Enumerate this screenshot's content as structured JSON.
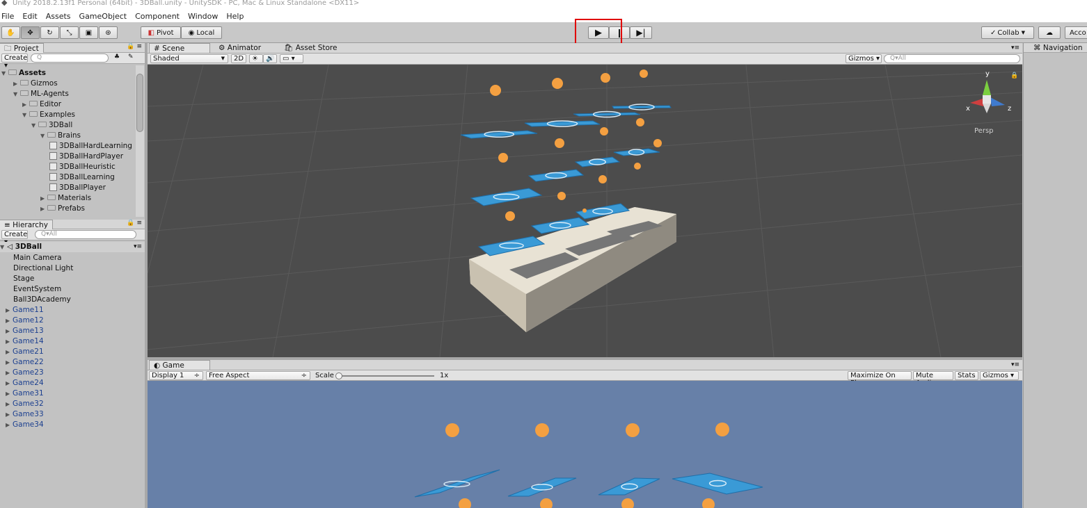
{
  "window": {
    "title": "Unity 2018.2.13f1 Personal (64bit) - 3DBall.unity - UnitySDK - PC, Mac & Linux Standalone <DX11>"
  },
  "menu": [
    "File",
    "Edit",
    "Assets",
    "GameObject",
    "Component",
    "Window",
    "Help"
  ],
  "toolbar": {
    "pivot": "Pivot",
    "local": "Local",
    "collab": "Collab",
    "account": "Acco"
  },
  "project": {
    "tab": "Project",
    "create": "Create",
    "items": [
      {
        "label": "Assets",
        "depth": 0,
        "expanded": true,
        "bold": true
      },
      {
        "label": "Gizmos",
        "depth": 1,
        "expanded": false
      },
      {
        "label": "ML-Agents",
        "depth": 1,
        "expanded": true
      },
      {
        "label": "Editor",
        "depth": 2,
        "expanded": false
      },
      {
        "label": "Examples",
        "depth": 2,
        "expanded": true
      },
      {
        "label": "3DBall",
        "depth": 3,
        "expanded": true
      },
      {
        "label": "Brains",
        "depth": 4,
        "expanded": true
      },
      {
        "label": "3DBallHardLearning",
        "depth": 5,
        "asset": true
      },
      {
        "label": "3DBallHardPlayer",
        "depth": 5,
        "asset": true
      },
      {
        "label": "3DBallHeuristic",
        "depth": 5,
        "asset": true
      },
      {
        "label": "3DBallLearning",
        "depth": 5,
        "asset": true
      },
      {
        "label": "3DBallPlayer",
        "depth": 5,
        "asset": true
      },
      {
        "label": "Materials",
        "depth": 4,
        "expanded": false
      },
      {
        "label": "Prefabs",
        "depth": 4,
        "expanded": false
      }
    ]
  },
  "hierarchy": {
    "tab": "Hierarchy",
    "create": "Create",
    "search_placeholder": "Q▾All",
    "scene": "3DBall",
    "items": [
      {
        "label": "Main Camera",
        "prefab": false,
        "expandable": false
      },
      {
        "label": "Directional Light",
        "prefab": false,
        "expandable": false
      },
      {
        "label": "Stage",
        "prefab": false,
        "expandable": false
      },
      {
        "label": "EventSystem",
        "prefab": false,
        "expandable": false
      },
      {
        "label": "Ball3DAcademy",
        "prefab": false,
        "expandable": false
      },
      {
        "label": "Game11",
        "prefab": true,
        "expandable": true
      },
      {
        "label": "Game12",
        "prefab": true,
        "expandable": true
      },
      {
        "label": "Game13",
        "prefab": true,
        "expandable": true
      },
      {
        "label": "Game14",
        "prefab": true,
        "expandable": true
      },
      {
        "label": "Game21",
        "prefab": true,
        "expandable": true
      },
      {
        "label": "Game22",
        "prefab": true,
        "expandable": true
      },
      {
        "label": "Game23",
        "prefab": true,
        "expandable": true
      },
      {
        "label": "Game24",
        "prefab": true,
        "expandable": true
      },
      {
        "label": "Game31",
        "prefab": true,
        "expandable": true
      },
      {
        "label": "Game32",
        "prefab": true,
        "expandable": true
      },
      {
        "label": "Game33",
        "prefab": true,
        "expandable": true
      },
      {
        "label": "Game34",
        "prefab": true,
        "expandable": true
      }
    ]
  },
  "scene_view": {
    "tabs": [
      "Scene",
      "Animator",
      "Asset Store"
    ],
    "shading": "Shaded",
    "mode_2d": "2D",
    "gizmos": "Gizmos",
    "search_placeholder": "Q▾All",
    "persp": "Persp",
    "axes": {
      "x": "x",
      "y": "y",
      "z": "z"
    }
  },
  "game_view": {
    "tab": "Game",
    "display": "Display 1",
    "aspect": "Free Aspect",
    "scale_label": "Scale",
    "scale_value": "1x",
    "maximize": "Maximize On Play",
    "mute": "Mute Audio",
    "stats": "Stats",
    "gizmos": "Gizmos"
  },
  "navigation": {
    "tab": "Navigation"
  },
  "colors": {
    "ball": "#f4a041",
    "platform": "#3a9ad6",
    "scene_bg": "#4c4c4c",
    "game_bg": "#6780a8",
    "highlight": "#e00000"
  }
}
